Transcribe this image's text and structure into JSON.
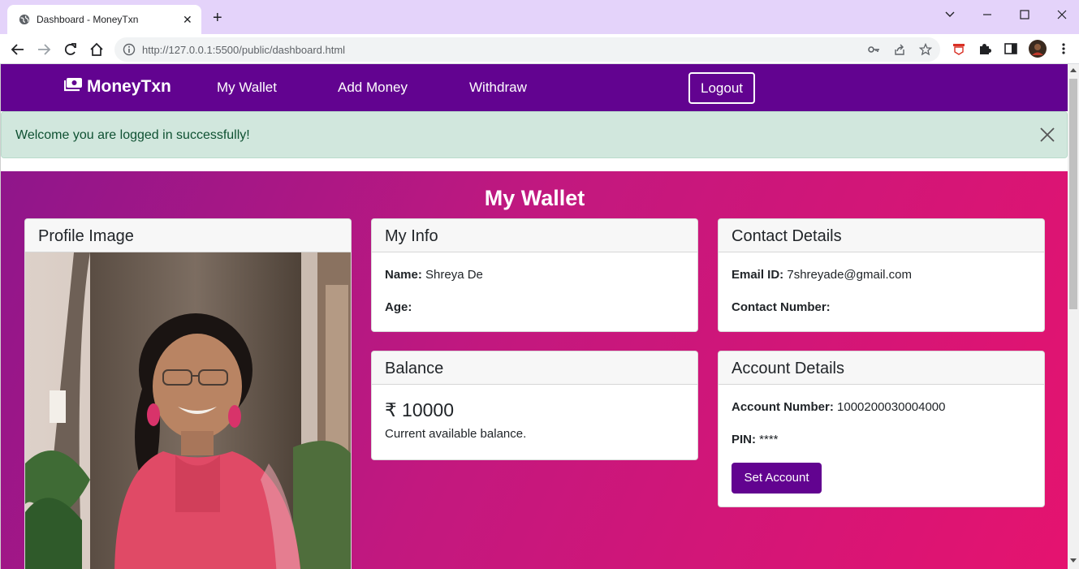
{
  "browser": {
    "tab_title": "Dashboard - MoneyTxn",
    "url": "http://127.0.0.1:5500/public/dashboard.html",
    "tab_close_glyph": "✕",
    "new_tab_glyph": "+"
  },
  "navbar": {
    "brand": "MoneyTxn",
    "links": [
      "My Wallet",
      "Add Money",
      "Withdraw"
    ],
    "logout": "Logout",
    "color": "#620390"
  },
  "alert": {
    "message": "Welcome you are logged in successfully!"
  },
  "wallet": {
    "title": "My Wallet",
    "profile": {
      "header": "Profile Image"
    },
    "my_info": {
      "header": "My Info",
      "name_label": "Name:",
      "name_value": "Shreya De",
      "age_label": "Age:",
      "age_value": ""
    },
    "contact": {
      "header": "Contact Details",
      "email_label": "Email ID:",
      "email_value": "7shreyade@gmail.com",
      "phone_label": "Contact Number:",
      "phone_value": ""
    },
    "balance": {
      "header": "Balance",
      "amount": "₹ 10000",
      "subtitle": "Current available balance."
    },
    "account": {
      "header": "Account Details",
      "number_label": "Account Number:",
      "number_value": "1000200030004000",
      "pin_label": "PIN:",
      "pin_value": "****",
      "button": "Set Account"
    }
  }
}
